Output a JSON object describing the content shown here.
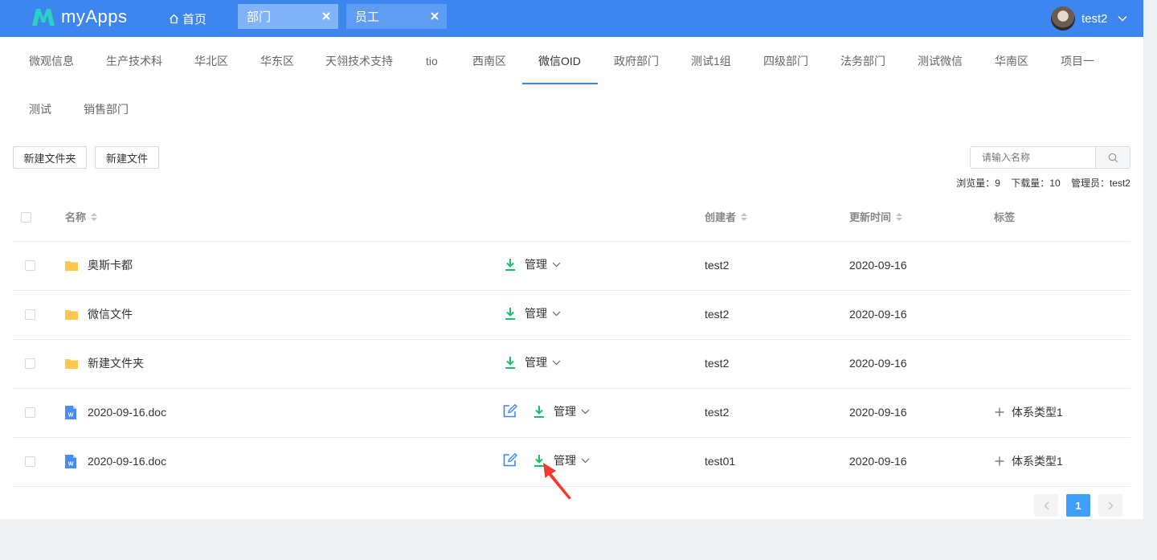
{
  "app": {
    "name": "myApps"
  },
  "nav": {
    "home_label": "首页",
    "tabs": [
      {
        "label": "部门",
        "active": true
      },
      {
        "label": "员工",
        "active": false
      }
    ]
  },
  "user": {
    "name": "test2"
  },
  "dept_tabs": [
    "微观信息",
    "生产技术科",
    "华北区",
    "华东区",
    "天翎技术支持",
    "tio",
    "西南区",
    "微信OID",
    "政府部门",
    "测试1组",
    "四级部门",
    "法务部门",
    "测试微信",
    "华南区",
    "项目一",
    "测试",
    "销售部门"
  ],
  "active_dept_tab": "微信OID",
  "toolbar": {
    "new_folder": "新建文件夹",
    "new_file": "新建文件"
  },
  "search": {
    "placeholder": "请输入名称"
  },
  "stats": {
    "views": "浏览量：9",
    "downloads": "下载量：10",
    "admin": "管理员：test2"
  },
  "table": {
    "headers": {
      "name": "名称",
      "creator": "创建者",
      "updated": "更新时间",
      "tags": "标签"
    },
    "manage_label": "管理",
    "rows": [
      {
        "type": "folder",
        "name": "奥斯卡都",
        "creator": "test2",
        "updated": "2020-09-16",
        "tag": ""
      },
      {
        "type": "folder",
        "name": "微信文件",
        "creator": "test2",
        "updated": "2020-09-16",
        "tag": ""
      },
      {
        "type": "folder",
        "name": "新建文件夹",
        "creator": "test2",
        "updated": "2020-09-16",
        "tag": ""
      },
      {
        "type": "doc",
        "name": "2020-09-16.doc",
        "creator": "test2",
        "updated": "2020-09-16",
        "tag": "体系类型1"
      },
      {
        "type": "doc",
        "name": "2020-09-16.doc",
        "creator": "test01",
        "updated": "2020-09-16",
        "tag": "体系类型1"
      }
    ]
  },
  "pagination": {
    "current": "1"
  },
  "colors": {
    "primary": "#3d86f0",
    "download_green": "#19be6b",
    "folder_yellow": "#ffc84d",
    "word_blue": "#4a8cf7",
    "annotation_red": "#f03a2e"
  }
}
